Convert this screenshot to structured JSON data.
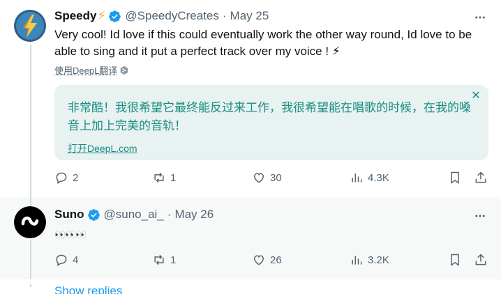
{
  "tweets": [
    {
      "name": "Speedy",
      "name_emoji": "⚡",
      "handle": "@SpeedyCreates",
      "separator": "·",
      "date": "May 25",
      "text": "Very cool! Id love if this could eventually work the other way round, Id love to be able to sing and it put a perfect track over my voice ! ⚡",
      "translate_label": "使用DeepL翻译",
      "translation": {
        "text": "非常酷！我很希望它最终能反过来工作，我很希望能在唱歌的时候，在我的嗓音上加上完美的音轨！",
        "open_label": "打开DeepL.com"
      },
      "stats": {
        "replies": "2",
        "reposts": "1",
        "likes": "30",
        "views": "4.3K"
      }
    },
    {
      "name": "Suno",
      "handle": "@suno_ai_",
      "separator": "·",
      "date": "May 26",
      "text": "👀👀👀",
      "stats": {
        "replies": "4",
        "reposts": "1",
        "likes": "26",
        "views": "3.2K"
      }
    }
  ],
  "show_replies_label": "Show replies",
  "colors": {
    "verified": "#1d9bf0",
    "deepl_accent": "#1a8c82",
    "muted": "#536471"
  },
  "icons": [
    "more-icon",
    "reply-icon",
    "repost-icon",
    "like-icon",
    "views-icon",
    "bookmark-icon",
    "share-icon",
    "verified-badge-icon",
    "deepl-icon",
    "close-icon"
  ]
}
